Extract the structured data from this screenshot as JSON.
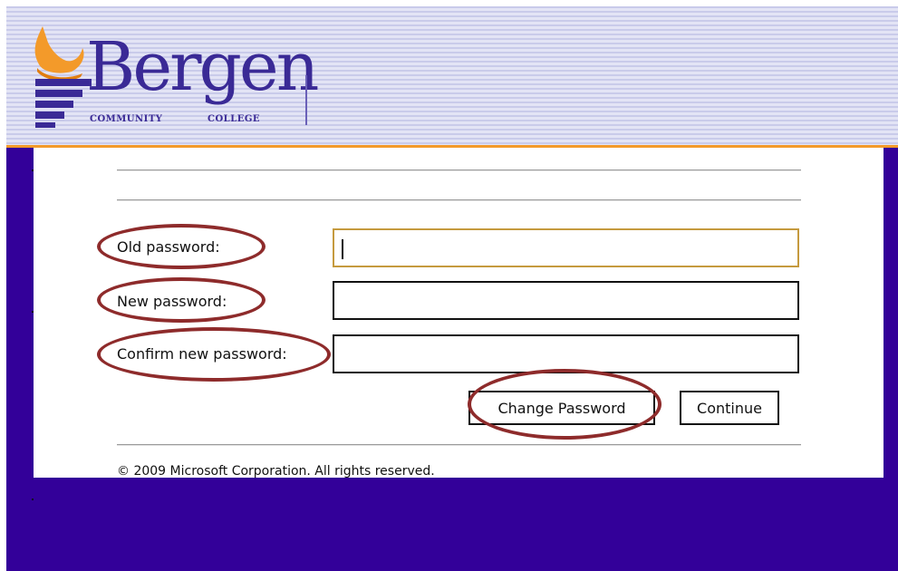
{
  "header": {
    "logo_word": "Bergen",
    "logo_sub_left": "COMMUNITY",
    "logo_sub_right": "COLLEGE",
    "logo_icon": "torch-icon",
    "colors": {
      "brand_purple": "#3a2a96",
      "flame_orange": "#f39a2a",
      "background": "#330099"
    }
  },
  "form": {
    "old_password_label": "Old password:",
    "old_password_value": "",
    "new_password_label": "New password:",
    "new_password_value": "",
    "confirm_password_label": "Confirm new password:",
    "confirm_password_value": "",
    "change_password_button": "Change Password",
    "continue_button": "Continue",
    "annotation_color": "#8e2b2b"
  },
  "footer": {
    "copyright": "© 2009 Microsoft Corporation. All rights reserved."
  }
}
